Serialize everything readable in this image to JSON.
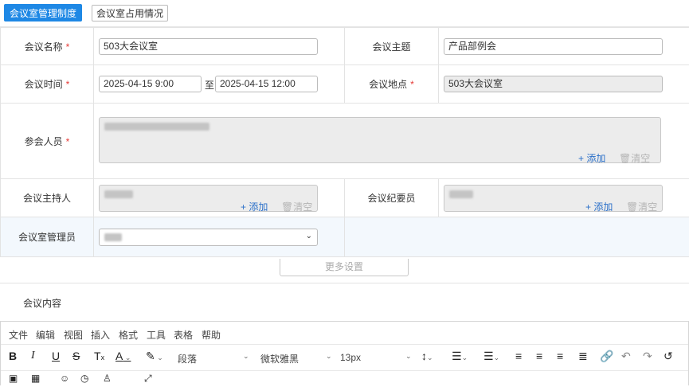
{
  "tabs": {
    "policy": "会议室管理制度",
    "occupancy": "会议室占用情况"
  },
  "form": {
    "meeting_name": {
      "label": "会议名称",
      "value": "503大会议室"
    },
    "meeting_topic": {
      "label": "会议主题",
      "value": "产品部例会"
    },
    "meeting_time": {
      "label": "会议时间",
      "start": "2025-04-15 9:00",
      "sep": "至",
      "end": "2025-04-15 12:00"
    },
    "meeting_location": {
      "label": "会议地点",
      "value": "503大会议室"
    },
    "attendees": {
      "label": "参会人员"
    },
    "host": {
      "label": "会议主持人"
    },
    "recorder": {
      "label": "会议纪要员"
    },
    "room_admin": {
      "label": "会议室管理员"
    },
    "required_mark": "*",
    "add_label": "+ 添加",
    "clear_label": "清空",
    "more_settings": "更多设置"
  },
  "content": {
    "label": "会议内容"
  },
  "editor": {
    "menu": [
      "文件",
      "编辑",
      "视图",
      "插入",
      "格式",
      "工具",
      "表格",
      "帮助"
    ],
    "paragraph": "段落",
    "font": "微软雅黑",
    "size": "13px"
  }
}
